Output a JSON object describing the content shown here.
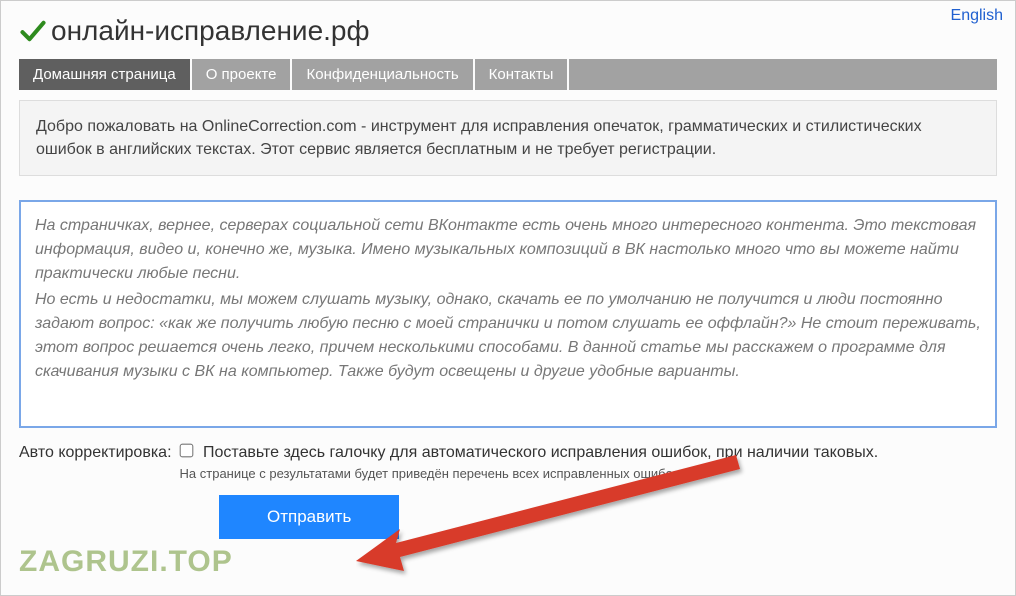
{
  "lang_link": "English",
  "site_title": "онлайн-исправление.рф",
  "nav": {
    "items": [
      {
        "label": "Домашняя страница",
        "active": true
      },
      {
        "label": "О проекте",
        "active": false
      },
      {
        "label": "Конфиденциальность",
        "active": false
      },
      {
        "label": "Контакты",
        "active": false
      }
    ]
  },
  "welcome_text": "Добро пожаловать на OnlineCorrection.com - инструмент для исправления опечаток, грамматических и стилистических ошибок в английских текстах. Этот сервис является бесплатным и не требует регистрации.",
  "textarea": {
    "p1": "На страничках, вернее, серверах социальной сети ВКонтакте есть очень много интересного контента. Это текстовая информация, видео и, конечно же, музыка. Имено музыкальных композиций в ВК настолько много что вы можете найти практически любые песни.",
    "p2": "Но есть и недостатки, мы можем слушать музыку, однако, скачать ее по умолчанию не получится и люди постоянно задают вопрос: «как же получить любую песню с моей странички и потом слушать ее оффлайн?» Не стоит переживать, этот вопрос решается очень легко, причем несколькими способами. В данной статье мы расскажем о программе для скачивания музыки с ВК на компьютер. Также будут освещены и другие удобные варианты."
  },
  "auto": {
    "label": "Авто корректировка:",
    "checkbox_label": "Поставьте здесь галочку для автоматического исправления ошибок, при наличии таковых.",
    "hint": "На странице с результатами будет приведён перечень всех исправленных ошибок."
  },
  "submit_label": "Отправить",
  "watermark": "ZAGRUZI.TOP"
}
